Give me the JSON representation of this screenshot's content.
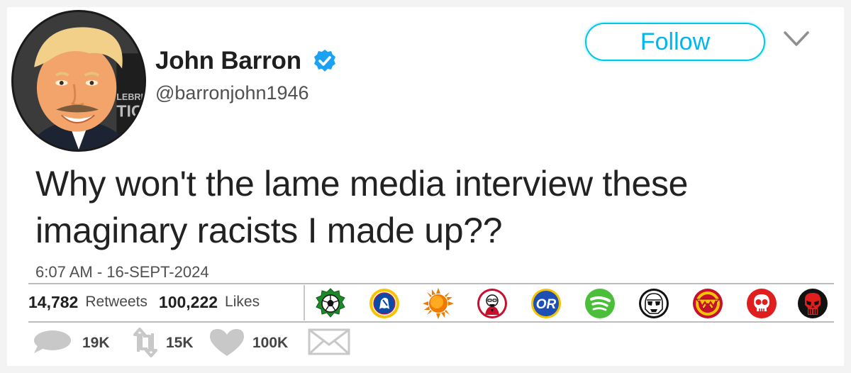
{
  "user": {
    "name": "John Barron",
    "handle": "@barronjohn1946",
    "avatar_caption_fragment": "LEBRIT TIC"
  },
  "header": {
    "follow_label": "Follow",
    "menu_icon": "chevron-down-icon",
    "verified_icon": "verified-badge-icon"
  },
  "tweet": {
    "text": "Why won't the lame media interview these imaginary racists I made up??",
    "timestamp": "6:07 AM - 16-SEPT-2024"
  },
  "stats": {
    "retweets_count": "14,782",
    "retweets_label": "Retweets",
    "likes_count": "100,222",
    "likes_label": "Likes"
  },
  "liker_badges": [
    {
      "name": "soccer-ball-badge",
      "colors": [
        "#1d8a2a",
        "#ffffff"
      ]
    },
    {
      "name": "chelsea-lion-badge",
      "colors": [
        "#f3c400",
        "#0b4aa8"
      ]
    },
    {
      "name": "sun-badge",
      "colors": [
        "#f07a00",
        "#ffcc00"
      ]
    },
    {
      "name": "kfc-colonel-badge",
      "colors": [
        "#c8102e",
        "#ffffff"
      ]
    },
    {
      "name": "or-logo-badge",
      "colors": [
        "#1d4fb5",
        "#f5c400"
      ]
    },
    {
      "name": "spotify-badge",
      "colors": [
        "#4cbf3a",
        "#ffffff"
      ]
    },
    {
      "name": "stormtrooper-badge",
      "colors": [
        "#111111",
        "#ffffff"
      ]
    },
    {
      "name": "wonder-woman-badge",
      "colors": [
        "#c8102e",
        "#f5c400"
      ]
    },
    {
      "name": "red-skull-badge",
      "colors": [
        "#e01e1e",
        "#ffffff"
      ]
    },
    {
      "name": "punisher-skull-badge",
      "colors": [
        "#111111",
        "#e01e1e"
      ]
    }
  ],
  "actions": {
    "reply_count": "19K",
    "retweet_count": "15K",
    "like_count": "100K",
    "reply_icon": "reply-bubble-icon",
    "retweet_icon": "retweet-icon",
    "like_icon": "heart-icon",
    "dm_icon": "envelope-icon"
  },
  "colors": {
    "accent": "#00b6ee",
    "verified": "#1da1f2",
    "action_gray": "#c8c8c8"
  }
}
